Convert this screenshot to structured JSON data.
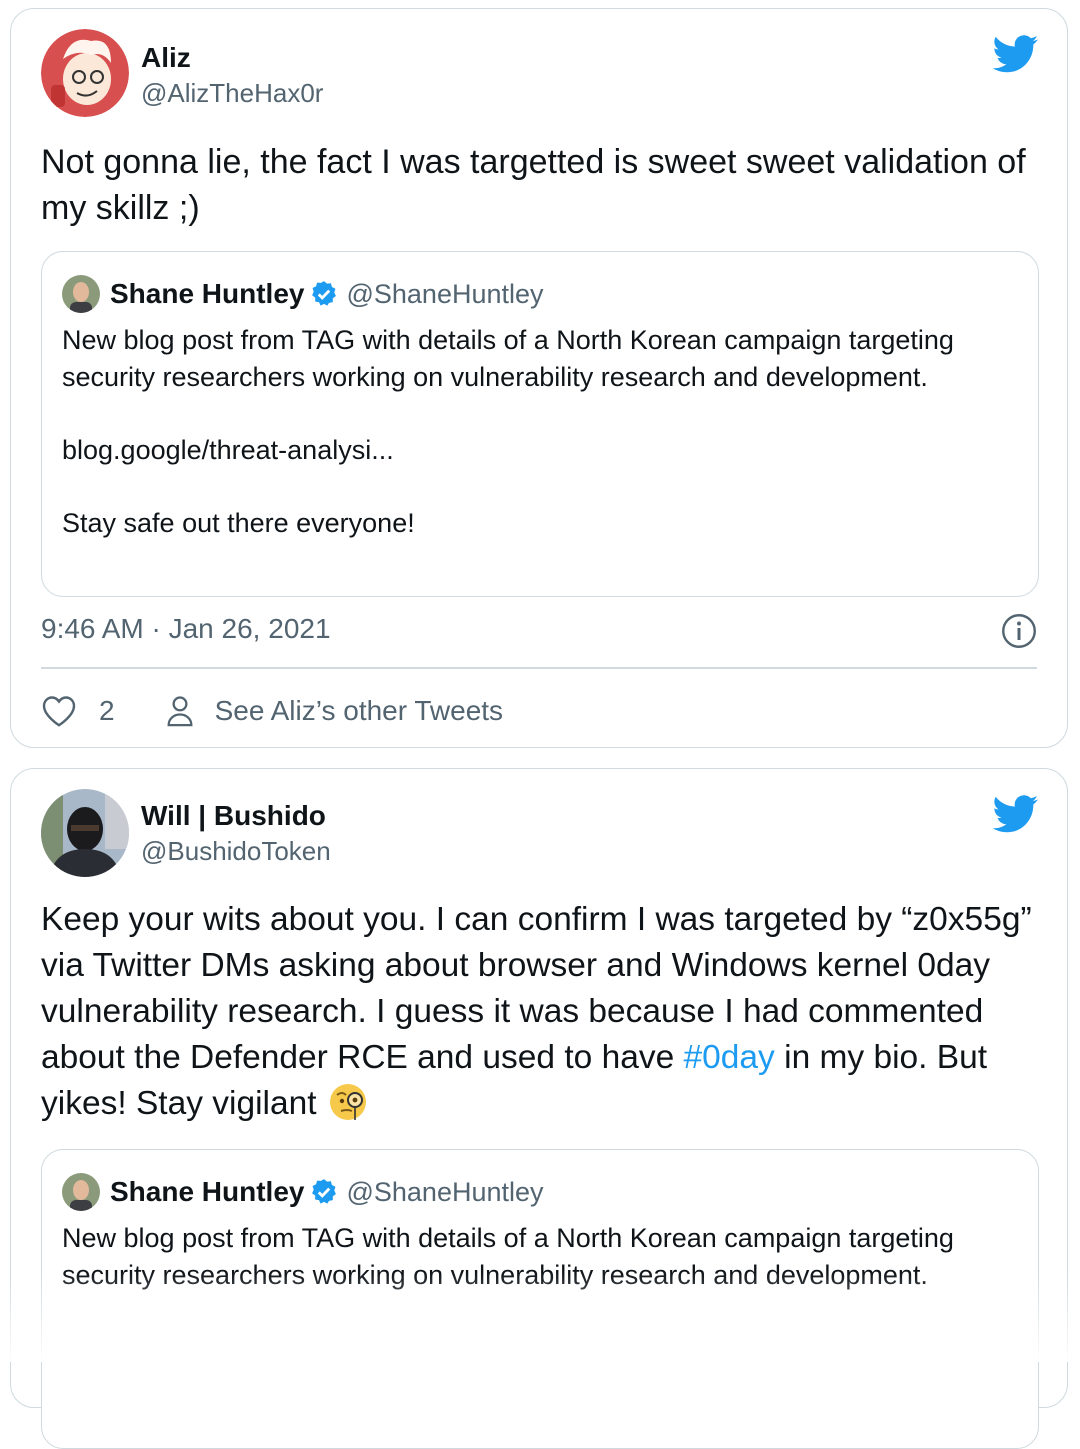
{
  "tweets": [
    {
      "author_name": "Aliz",
      "author_handle": "@AlizTheHax0r",
      "text": "Not gonna lie, the fact I was targetted is sweet sweet validation of my skillz ;)",
      "quote": {
        "author_name": "Shane Huntley",
        "author_handle": "@ShaneHuntley",
        "paragraphs": [
          "New blog post from TAG with details of a North Korean campaign targeting security researchers working on vulnerability research and development.",
          "blog.google/threat-analysi...",
          "Stay safe out there everyone!"
        ]
      },
      "timestamp": "9:46 AM · Jan 26, 2021",
      "like_count": "2",
      "other_tweets_label": "See Aliz’s other Tweets"
    },
    {
      "author_name": "Will | Bushido",
      "author_handle": "@BushidoToken",
      "text_before_hashtag": "Keep your wits about you. I can confirm I was targeted by “z0x55g” via Twitter DMs asking about browser and Windows kernel 0day vulnerability research. I guess it was because I had commented about the Defender RCE and used to have ",
      "hashtag": "#0day",
      "text_after_hashtag": " in my bio. But yikes! Stay vigilant",
      "emoji": "face-with-monocle",
      "quote": {
        "author_name": "Shane Huntley",
        "author_handle": "@ShaneHuntley",
        "paragraphs": [
          "New blog post from TAG with details of a North Korean campaign targeting security researchers working on vulnerability research and development."
        ]
      }
    }
  ],
  "colors": {
    "twitter_blue": "#1d9bf0",
    "secondary_text": "#536471",
    "border": "#cfd9de"
  },
  "icons": [
    "twitter-bird-icon",
    "verified-badge-icon",
    "info-icon",
    "heart-icon",
    "person-icon",
    "face-with-monocle-emoji"
  ]
}
